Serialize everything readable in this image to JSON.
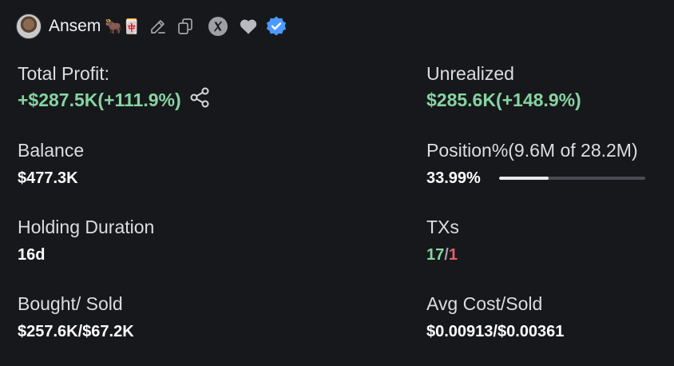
{
  "profile": {
    "name": "Ansem",
    "emojis": "🐂🀄",
    "icons": [
      "edit-icon",
      "copy-icon",
      "x-logo-icon",
      "heart-icon",
      "verified-badge-icon"
    ],
    "verified_color": "#4c9aff"
  },
  "stats": {
    "total_profit": {
      "label": "Total Profit:",
      "value": "+$287.5K(+111.9%)"
    },
    "unrealized": {
      "label": "Unrealized",
      "value": "$285.6K(+148.9%)"
    },
    "balance": {
      "label": "Balance",
      "value": "$477.3K"
    },
    "position": {
      "label": "Position%(9.6M of 28.2M)",
      "value": "33.99%",
      "fraction": 0.3399
    },
    "holding_duration": {
      "label": "Holding Duration",
      "value": "16d"
    },
    "txs": {
      "label": "TXs",
      "buys": "17",
      "separator": "/",
      "sells": "1"
    },
    "bought_sold": {
      "label": "Bought/ Sold",
      "value": "$257.6K/$67.2K"
    },
    "avg_cost_sold": {
      "label": "Avg Cost/Sold",
      "value": "$0.00913/$0.00361"
    }
  },
  "colors": {
    "background": "#17181c",
    "positive": "#86d4a0",
    "negative": "#e0606e"
  }
}
